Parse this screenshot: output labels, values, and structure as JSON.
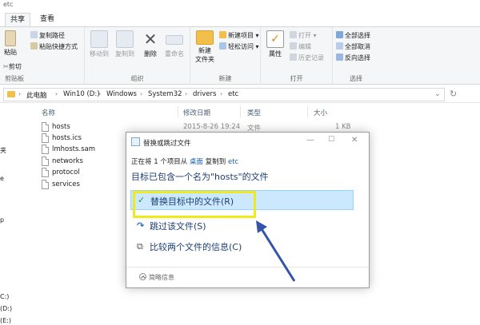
{
  "window": {
    "title": "etc"
  },
  "ribbon_tabs": [
    {
      "label": "共享"
    },
    {
      "label": "查看"
    }
  ],
  "ribbon": {
    "clipboard": {
      "pin_label": "钉到",
      "quick_access": "访问",
      "copy_path": "复制路径",
      "paste": "粘贴",
      "paste_shortcut": "粘贴快捷方式",
      "cut": "剪切",
      "group_label": "剪贴板"
    },
    "organize": {
      "move_to": "移动到",
      "copy_to": "复制到",
      "delete": "删除",
      "rename": "重命名",
      "group_label": "组织"
    },
    "new": {
      "new_folder_line1": "新建",
      "new_folder_line2": "文件夹",
      "new_item": "新建项目",
      "easy_access": "轻松访问",
      "group_label": "新建"
    },
    "open": {
      "properties": "属性",
      "open": "打开",
      "edit": "编辑",
      "history": "历史记录",
      "group_label": "打开"
    },
    "select": {
      "select_all": "全部选择",
      "select_none": "全部取消",
      "invert": "反向选择",
      "group_label": "选择"
    }
  },
  "address": {
    "crumbs": [
      "此电脑",
      "Win10 (D:)",
      "Windows",
      "System32",
      "drivers",
      "etc"
    ]
  },
  "nav_pane": {
    "items": [
      "夹",
      "e",
      "p",
      "C:)",
      "(D:)",
      "(E:)"
    ]
  },
  "columns": {
    "name": "名称",
    "modified": "修改日期",
    "type": "类型",
    "size": "大小"
  },
  "files": [
    {
      "name": "hosts",
      "modified": "2015-8-26 19:24",
      "type": "文件",
      "size": "1 KB"
    },
    {
      "name": "hosts.ics"
    },
    {
      "name": "lmhosts.sam"
    },
    {
      "name": "networks"
    },
    {
      "name": "protocol"
    },
    {
      "name": "services"
    }
  ],
  "dialog": {
    "title": "替换或跳过文件",
    "progress_prefix": "正在将 1 个项目从",
    "source": "桌面",
    "progress_mid": "复制到",
    "dest": "etc",
    "message": "目标已包含一个名为\"hosts\"的文件",
    "options": [
      {
        "label": "替换目标中的文件(R)"
      },
      {
        "label": "跳过该文件(S)"
      },
      {
        "label": "比较两个文件的信息(C)"
      }
    ],
    "details": "简略信息"
  },
  "colors": {
    "accent": "#1a5fb4",
    "highlight_bg": "#cce8ff",
    "highlight_border": "#99d1ff",
    "annotation_yellow": "#f0ea1a",
    "arrow_blue": "#3553a8"
  }
}
